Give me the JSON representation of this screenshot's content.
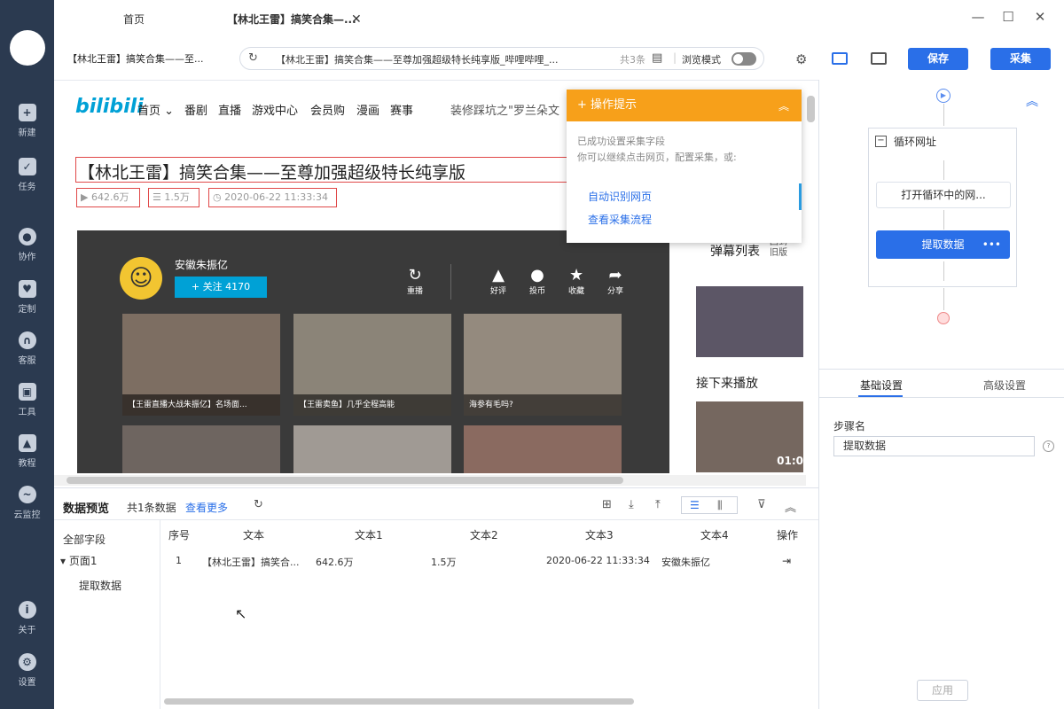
{
  "tabs": [
    {
      "label": "首页"
    },
    {
      "label": "【林北王雷】搞笑合集—..."
    }
  ],
  "window": {
    "minimize": "—",
    "maximize": "☐",
    "close": "✕"
  },
  "address": {
    "page_title": "【林北王雷】搞笑合集——至...",
    "url": "【林北王雷】搞笑合集——至尊加强超级特长纯享版_哔哩哔哩_...",
    "count": "共3条",
    "browse_mode": "浏览模式",
    "save": "保存",
    "collect": "采集"
  },
  "left_nav": [
    {
      "label": "新建",
      "icon": "plus-icon"
    },
    {
      "label": "任务",
      "icon": "task-icon"
    },
    {
      "label": "协作",
      "icon": "users-icon"
    },
    {
      "label": "定制",
      "icon": "heart-icon"
    },
    {
      "label": "客服",
      "icon": "headset-icon"
    },
    {
      "label": "工具",
      "icon": "toolbox-icon"
    },
    {
      "label": "教程",
      "icon": "graduation-icon"
    },
    {
      "label": "云监控",
      "icon": "cloud-monitor-icon"
    },
    {
      "label": "关于",
      "icon": "info-icon"
    },
    {
      "label": "设置",
      "icon": "gear-icon"
    }
  ],
  "bili": {
    "logo": "bilibili",
    "nav": [
      "首页",
      "番剧",
      "直播",
      "游戏中心",
      "会员购",
      "漫画",
      "赛事"
    ],
    "search_hint": "装修踩坑之\"罗兰朵文",
    "title": "【林北王雷】搞笑合集——至尊加强超级特长纯享版",
    "views": "642.6万",
    "danmaku": "1.5万",
    "date": "2020-06-22 11:33:34",
    "uploader": "安徽朱振亿",
    "follow": "+ 关注 4170",
    "replay": "重播",
    "actions": [
      "好评",
      "投币",
      "收藏",
      "分享"
    ],
    "thumbs": [
      "【王雷直播大战朱振亿】名场面...",
      "【王雷卖鱼】几乎全程高能",
      "海参有毛吗?",
      "",
      "",
      ""
    ],
    "danmaku_list": "弹幕列表",
    "old_version": "回到旧版",
    "next_up": "接下来播放",
    "time": "01:0"
  },
  "tip": {
    "title": "+ 操作提示",
    "line1": "已成功设置采集字段",
    "line2": "你可以继续点击网页，配置采集，或:",
    "link1": "自动识别网页",
    "link2": "查看采集流程"
  },
  "flow": {
    "loop": "循环网址",
    "open": "打开循环中的网...",
    "extract": "提取数据",
    "more": "•••"
  },
  "settings": {
    "tab_basic": "基础设置",
    "tab_adv": "高级设置",
    "step_label": "步骤名",
    "step_value": "提取数据",
    "apply": "应用"
  },
  "preview": {
    "title": "数据预览",
    "count": "共1条数据",
    "more": "查看更多",
    "tree": {
      "all": "全部字段",
      "page": "页面1",
      "extract": "提取数据"
    },
    "columns": [
      "序号",
      "文本",
      "文本1",
      "文本2",
      "文本3",
      "文本4",
      "操作"
    ],
    "row": [
      "1",
      "【林北王雷】搞笑合...",
      "642.6万",
      "1.5万",
      "2020-06-22 11:33:34",
      "安徽朱振亿"
    ]
  }
}
